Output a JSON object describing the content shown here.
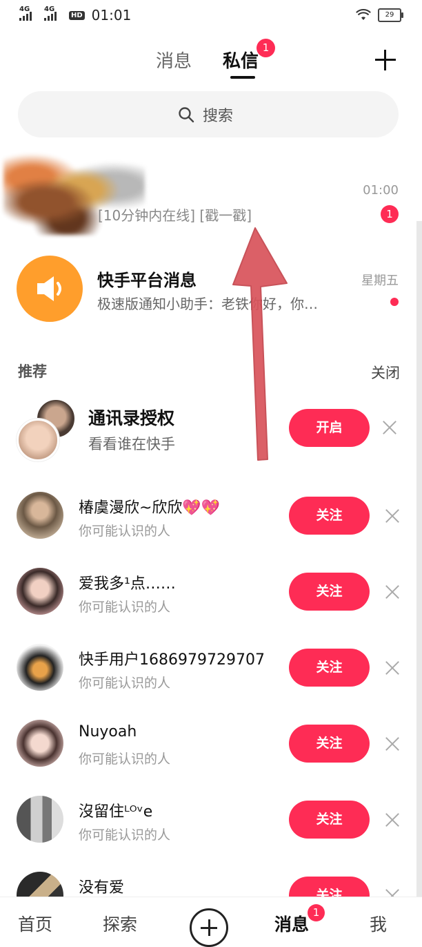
{
  "status_bar": {
    "net1": "4G",
    "net2": "4G",
    "hd": "HD",
    "time": "01:01",
    "battery": "29"
  },
  "header": {
    "tabs": [
      {
        "label": "消息"
      },
      {
        "label": "私信",
        "badge": "1"
      }
    ]
  },
  "search": {
    "placeholder": "搜索"
  },
  "conversations": [
    {
      "preview": "[10分钟内在线] [戳一戳]",
      "time": "01:00",
      "unread": "1"
    },
    {
      "name": "快手平台消息",
      "preview": "极速版通知小助手：老铁你好，你…",
      "time": "星期五"
    }
  ],
  "recommend": {
    "title": "推荐",
    "close_label": "关闭",
    "contacts": {
      "title": "通讯录授权",
      "subtitle": "看看谁在快手",
      "button": "开启"
    },
    "users": [
      {
        "name": "椿虞漫欣~欣欣💖💖",
        "subtitle": "你可能认识的人",
        "button": "关注"
      },
      {
        "name": "爱我多¹点……",
        "subtitle": "你可能认识的人",
        "button": "关注"
      },
      {
        "name": "快手用户1686979729707",
        "subtitle": "你可能认识的人",
        "button": "关注"
      },
      {
        "name": "Nuyoah",
        "subtitle": "你可能认识的人",
        "button": "关注"
      },
      {
        "name": "沒留住ᴸᴼᵛe",
        "subtitle": "你可能认识的人",
        "button": "关注"
      },
      {
        "name": "没有爱",
        "subtitle": "",
        "button": "关注"
      }
    ]
  },
  "bottom_nav": {
    "items": [
      {
        "label": "首页"
      },
      {
        "label": "探索"
      },
      {
        "label": "消息",
        "badge": "1"
      },
      {
        "label": "我"
      }
    ]
  },
  "colors": {
    "accent": "#fe2c55",
    "system_avatar": "#ff9e2c",
    "arrow": "#d9535b"
  }
}
